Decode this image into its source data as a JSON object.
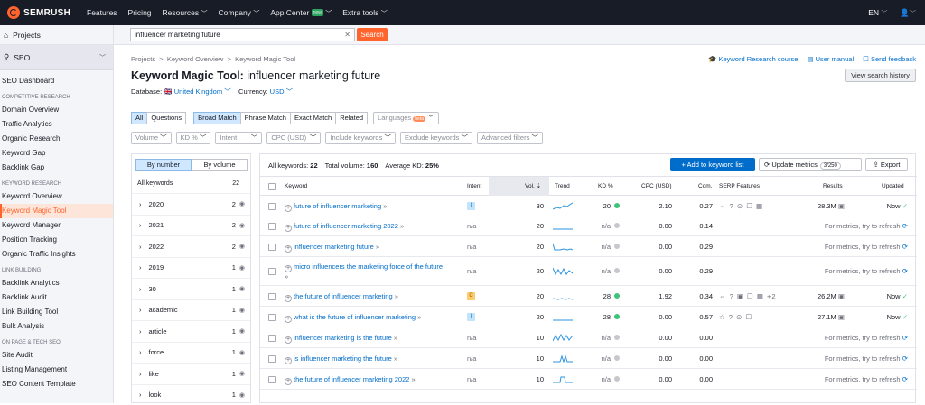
{
  "topbar": {
    "brand": "SEMRUSH",
    "nav": [
      "Features",
      "Pricing",
      "Resources",
      "Company",
      "App Center",
      "Extra tools"
    ],
    "new_badge": "new",
    "lang": "EN"
  },
  "sidebar": {
    "projects": "Projects",
    "seo": "SEO",
    "items": [
      {
        "type": "item",
        "label": "SEO Dashboard"
      },
      {
        "type": "head",
        "label": "COMPETITIVE RESEARCH"
      },
      {
        "type": "item",
        "label": "Domain Overview"
      },
      {
        "type": "item",
        "label": "Traffic Analytics"
      },
      {
        "type": "item",
        "label": "Organic Research"
      },
      {
        "type": "item",
        "label": "Keyword Gap"
      },
      {
        "type": "item",
        "label": "Backlink Gap"
      },
      {
        "type": "head",
        "label": "KEYWORD RESEARCH"
      },
      {
        "type": "item",
        "label": "Keyword Overview"
      },
      {
        "type": "item",
        "label": "Keyword Magic Tool",
        "active": true
      },
      {
        "type": "item",
        "label": "Keyword Manager"
      },
      {
        "type": "item",
        "label": "Position Tracking"
      },
      {
        "type": "item",
        "label": "Organic Traffic Insights"
      },
      {
        "type": "head",
        "label": "LINK BUILDING"
      },
      {
        "type": "item",
        "label": "Backlink Analytics"
      },
      {
        "type": "item",
        "label": "Backlink Audit"
      },
      {
        "type": "item",
        "label": "Link Building Tool"
      },
      {
        "type": "item",
        "label": "Bulk Analysis"
      },
      {
        "type": "head",
        "label": "ON PAGE & TECH SEO"
      },
      {
        "type": "item",
        "label": "Site Audit"
      },
      {
        "type": "item",
        "label": "Listing Management"
      },
      {
        "type": "item",
        "label": "SEO Content Template"
      }
    ]
  },
  "search": {
    "value": "influencer marketing future",
    "button": "Search"
  },
  "breadcrumb": {
    "projects": "Projects",
    "overview": "Keyword Overview",
    "current": "Keyword Magic Tool"
  },
  "page": {
    "title": "Keyword Magic Tool:",
    "query": "influencer marketing future",
    "db_label": "Database:",
    "db_value": "United Kingdom",
    "cur_label": "Currency:",
    "cur_value": "USD"
  },
  "links": {
    "course": "Keyword Research course",
    "manual": "User manual",
    "feedback": "Send feedback",
    "history": "View search history"
  },
  "filters1": {
    "all": "All",
    "questions": "Questions",
    "broad": "Broad Match",
    "phrase": "Phrase Match",
    "exact": "Exact Match",
    "related": "Related",
    "languages": "Languages",
    "beta": "beta"
  },
  "filters2": {
    "volume": "Volume",
    "kd": "KD %",
    "intent": "Intent",
    "cpc": "CPC (USD)",
    "include": "Include keywords",
    "exclude": "Exclude keywords",
    "advanced": "Advanced filters"
  },
  "groups": {
    "by_number": "By number",
    "by_volume": "By volume",
    "all_label": "All keywords",
    "all_count": "22",
    "rows": [
      {
        "label": "2020",
        "count": "2"
      },
      {
        "label": "2021",
        "count": "2"
      },
      {
        "label": "2022",
        "count": "2"
      },
      {
        "label": "2019",
        "count": "1"
      },
      {
        "label": "30",
        "count": "1"
      },
      {
        "label": "academic",
        "count": "1"
      },
      {
        "label": "article",
        "count": "1"
      },
      {
        "label": "force",
        "count": "1"
      },
      {
        "label": "like",
        "count": "1"
      },
      {
        "label": "look",
        "count": "1"
      }
    ]
  },
  "summary": {
    "all_label": "All keywords:",
    "all_value": "22",
    "vol_label": "Total volume:",
    "vol_value": "160",
    "kd_label": "Average KD:",
    "kd_value": "25%"
  },
  "actions": {
    "add": "+ Add to keyword list",
    "update": "Update metrics",
    "update_count": "3/250",
    "export": "Export"
  },
  "columns": {
    "keyword": "Keyword",
    "intent": "Intent",
    "vol": "Vol.",
    "trend": "Trend",
    "kd": "KD %",
    "cpc": "CPC (USD)",
    "com": "Com.",
    "serp": "SERP Features",
    "results": "Results",
    "updated": "Updated"
  },
  "rows": [
    {
      "keyword": "future of influencer marketing",
      "intent": "I",
      "vol": "30",
      "kd": "20",
      "kd_color": "#3ec47a",
      "cpc": "2.10",
      "com": "0.27",
      "serp": "⇔ ? ⊙ ☐ ▦",
      "results": "28.3M",
      "updated": "Now",
      "status": "now"
    },
    {
      "keyword": "future of influencer marketing 2022",
      "intent": "n/a",
      "vol": "20",
      "kd": "n/a",
      "kd_color": "#c7c8ce",
      "cpc": "0.00",
      "com": "0.14",
      "serp": "",
      "results": "",
      "updated": "For metrics, try to refresh",
      "status": "refresh"
    },
    {
      "keyword": "influencer marketing future",
      "intent": "n/a",
      "vol": "20",
      "kd": "n/a",
      "kd_color": "#c7c8ce",
      "cpc": "0.00",
      "com": "0.29",
      "serp": "",
      "results": "",
      "updated": "For metrics, try to refresh",
      "status": "refresh"
    },
    {
      "keyword": "micro influencers the marketing force of the future",
      "intent": "n/a",
      "vol": "20",
      "kd": "n/a",
      "kd_color": "#c7c8ce",
      "cpc": "0.00",
      "com": "0.29",
      "serp": "",
      "results": "",
      "updated": "For metrics, try to refresh",
      "status": "refresh"
    },
    {
      "keyword": "the future of influencer marketing",
      "intent": "C",
      "vol": "20",
      "kd": "28",
      "kd_color": "#3ec47a",
      "cpc": "1.92",
      "com": "0.34",
      "serp": "⇔ ? ▣ ☐ ▦ +2",
      "results": "26.2M",
      "updated": "Now",
      "status": "now"
    },
    {
      "keyword": "what is the future of influencer marketing",
      "intent": "I",
      "vol": "20",
      "kd": "28",
      "kd_color": "#3ec47a",
      "cpc": "0.00",
      "com": "0.57",
      "serp": "☆ ? ⊙ ☐",
      "results": "27.1M",
      "updated": "Now",
      "status": "now"
    },
    {
      "keyword": "influencer marketing is the future",
      "intent": "n/a",
      "vol": "10",
      "kd": "n/a",
      "kd_color": "#c7c8ce",
      "cpc": "0.00",
      "com": "0.00",
      "serp": "",
      "results": "",
      "updated": "For metrics, try to refresh",
      "status": "refresh"
    },
    {
      "keyword": "is influencer marketing the future",
      "intent": "n/a",
      "vol": "10",
      "kd": "n/a",
      "kd_color": "#c7c8ce",
      "cpc": "0.00",
      "com": "0.00",
      "serp": "",
      "results": "",
      "updated": "For metrics, try to refresh",
      "status": "refresh"
    },
    {
      "keyword": "the future of influencer marketing 2022",
      "intent": "n/a",
      "vol": "10",
      "kd": "n/a",
      "kd_color": "#c7c8ce",
      "cpc": "0.00",
      "com": "0.00",
      "serp": "",
      "results": "",
      "updated": "For metrics, try to refresh",
      "status": "refresh"
    }
  ],
  "colors": {
    "brand": "#ff642d",
    "topbar": "#181c27",
    "link": "#006dca",
    "selected": "#cfe7ff",
    "green": "#3ec47a"
  }
}
